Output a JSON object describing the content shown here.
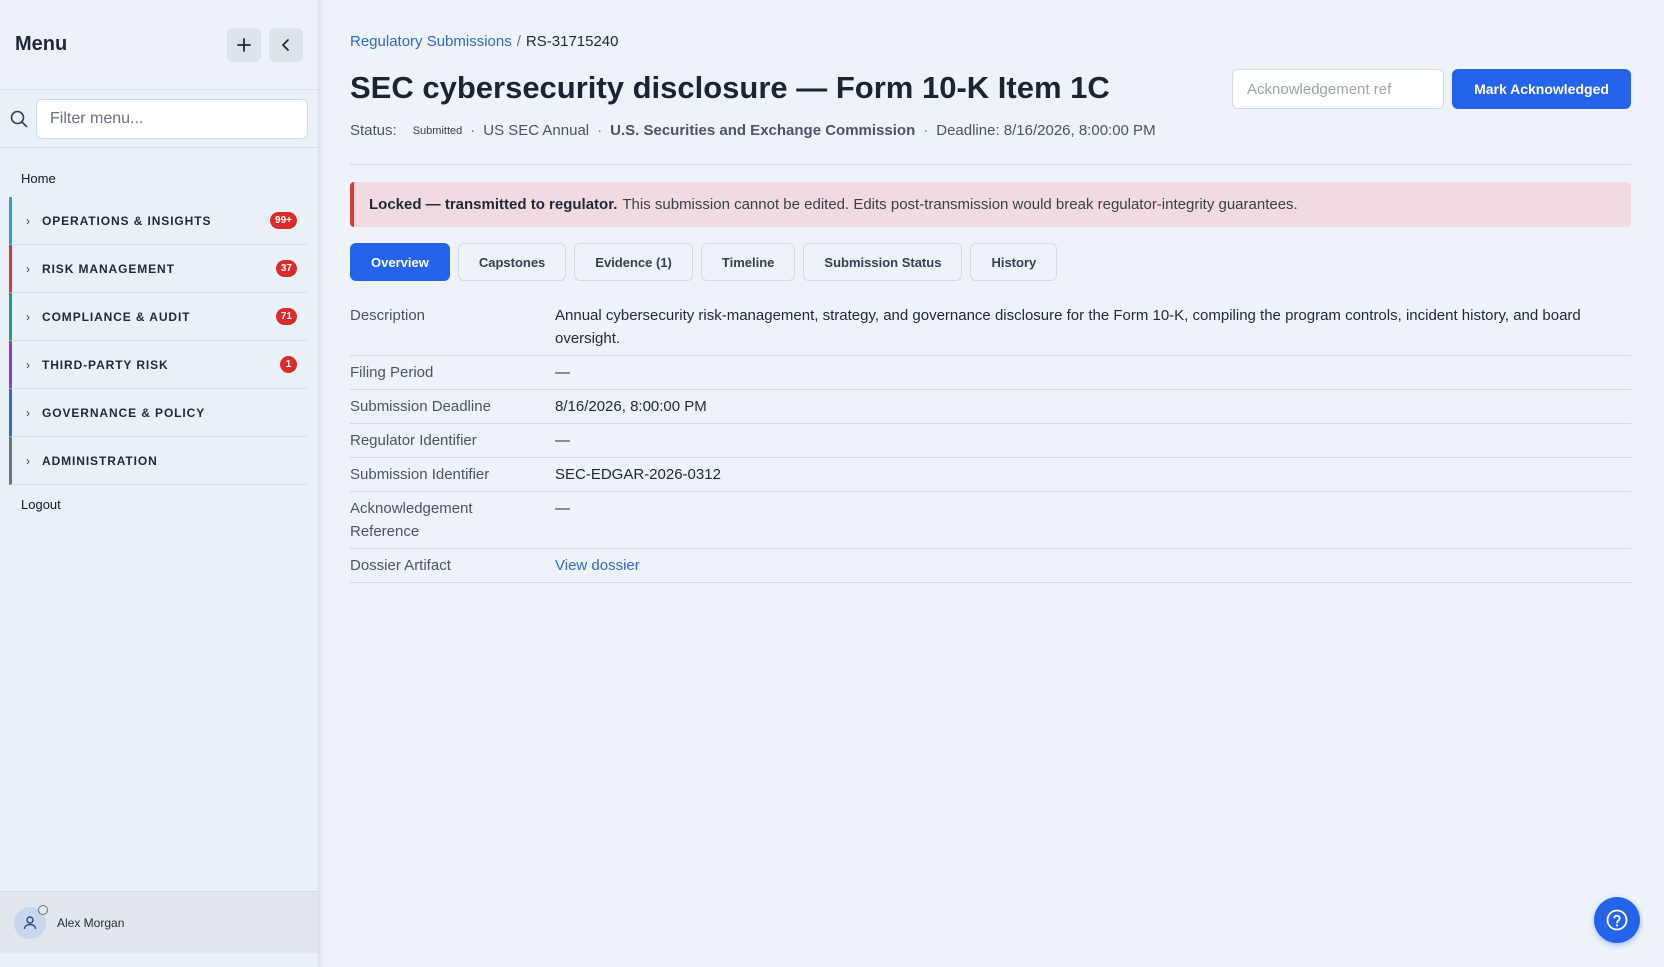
{
  "sidebar": {
    "title": "Menu",
    "filter_placeholder": "Filter menu...",
    "home": "Home",
    "groups": [
      {
        "label": "OPERATIONS & INSIGHTS",
        "badge": "99+",
        "color": "#2aa6c4"
      },
      {
        "label": "RISK MANAGEMENT",
        "badge": "37",
        "color": "#d33b3b"
      },
      {
        "label": "COMPLIANCE & AUDIT",
        "badge": "71",
        "color": "#22a06b"
      },
      {
        "label": "THIRD-PARTY RISK",
        "badge": "1",
        "color": "#8b3fd1"
      },
      {
        "label": "GOVERNANCE & POLICY",
        "badge": "",
        "color": "#2f6ac4"
      },
      {
        "label": "ADMINISTRATION",
        "badge": "",
        "color": "#6b7280"
      }
    ],
    "logout": "Logout",
    "user": "Alex Morgan"
  },
  "breadcrumb": {
    "parent": "Regulatory Submissions",
    "separator": "/",
    "current": "RS-31715240"
  },
  "page": {
    "title": "SEC cybersecurity disclosure — Form 10-K Item 1C",
    "status_label": "Status:",
    "status_value": "Submitted",
    "framework": "US SEC Annual",
    "regulator": "U.S. Securities and Exchange Commission",
    "deadline": "Deadline: 8/16/2026, 8:00:00 PM"
  },
  "actions": {
    "ack_placeholder": "Acknowledgement ref",
    "mark_label": "Mark Acknowledged"
  },
  "banner": {
    "bold": "Locked — transmitted to regulator.",
    "text": "This submission cannot be edited. Edits post-transmission would break regulator-integrity guarantees."
  },
  "tabs": [
    "Overview",
    "Capstones",
    "Evidence (1)",
    "Timeline",
    "Submission Status",
    "History"
  ],
  "details": [
    {
      "key": "Description",
      "value": "Annual cybersecurity risk-management, strategy, and governance disclosure for the Form 10-K, compiling the program controls, incident history, and board oversight."
    },
    {
      "key": "Filing Period",
      "value": "—"
    },
    {
      "key": "Submission Deadline",
      "value": "8/16/2026, 8:00:00 PM"
    },
    {
      "key": "Regulator Identifier",
      "value": "—"
    },
    {
      "key": "Submission Identifier",
      "value": "SEC-EDGAR-2026-0312"
    },
    {
      "key": "Acknowledgement Reference",
      "value": "—"
    },
    {
      "key": "Dossier Artifact",
      "value": "View dossier"
    }
  ]
}
